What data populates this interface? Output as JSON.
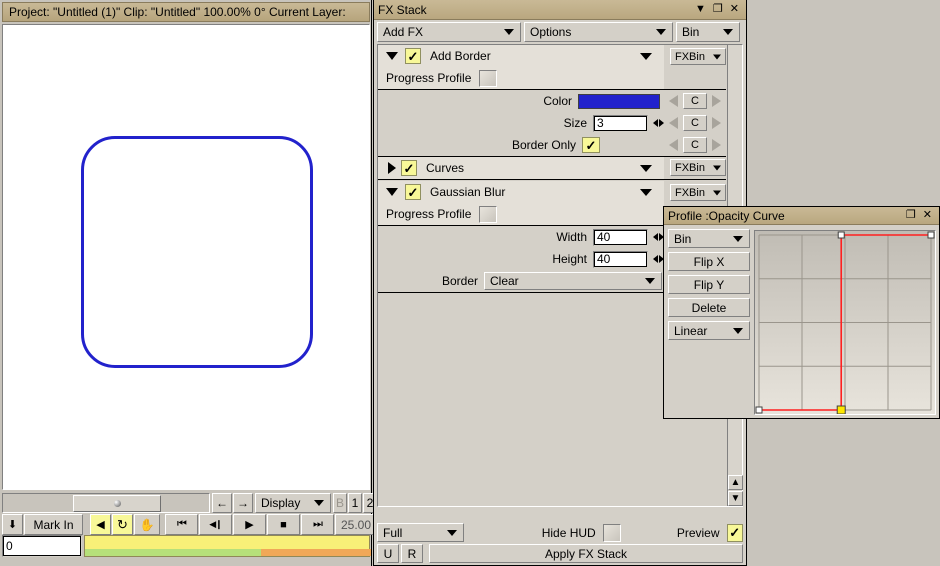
{
  "project": {
    "titlebar": "Project: \"Untitled (1)\"  Clip: \"Untitled\"   100.00%   0°  Current Layer:",
    "canvas_shape_color": "#2222cc"
  },
  "transport": {
    "mark_in": "Mark In",
    "down_arrow": "⬇",
    "fps": "25.00",
    "frame_value": "0",
    "buttons": [
      {
        "name": "loop-left-icon",
        "glyph": "◀",
        "active": true
      },
      {
        "name": "loop-cycle-icon",
        "glyph": "↻",
        "active": true
      },
      {
        "name": "hand-pan-icon",
        "glyph": "✋",
        "active": false
      },
      {
        "name": "go-to-start-icon",
        "glyph": "⏮",
        "active": false
      },
      {
        "name": "step-back-icon",
        "glyph": "◀❙",
        "active": false
      },
      {
        "name": "play-icon",
        "glyph": "▶",
        "active": false
      },
      {
        "name": "stop-icon",
        "glyph": "■",
        "active": false
      },
      {
        "name": "go-to-end-icon",
        "glyph": "⏭",
        "active": false
      }
    ]
  },
  "display_bar": {
    "left_arrow": "←",
    "right_arrow": "→",
    "display_label": "Display",
    "small_buttons": [
      "B",
      "1",
      "2"
    ]
  },
  "fx_stack": {
    "title": "FX Stack",
    "title_buttons": [
      "menu-chevron",
      "restore",
      "close"
    ],
    "toolbar": {
      "add_fx": "Add FX",
      "options": "Options",
      "bin": "Bin"
    },
    "effects": [
      {
        "name": "Add Border",
        "expanded": true,
        "enabled": true,
        "bin_label": "FXBin",
        "progress_profile_label": "Progress Profile",
        "params": [
          {
            "label": "Color",
            "type": "color",
            "value": "#2222cc",
            "c_button": "C"
          },
          {
            "label": "Size",
            "type": "text",
            "value": "3",
            "c_button": "C"
          },
          {
            "label": "Border Only",
            "type": "check",
            "value": true,
            "c_button": "C"
          }
        ]
      },
      {
        "name": "Curves",
        "expanded": false,
        "enabled": true,
        "bin_label": "FXBin",
        "params": []
      },
      {
        "name": "Gaussian Blur",
        "expanded": true,
        "enabled": true,
        "bin_label": "FXBin",
        "progress_profile_label": "Progress Profile",
        "params": [
          {
            "label": "Width",
            "type": "text",
            "value": "40"
          },
          {
            "label": "Height",
            "type": "text",
            "value": "40"
          },
          {
            "label": "Border",
            "type": "combo",
            "value": "Clear"
          }
        ]
      }
    ],
    "footer": {
      "quality": "Full",
      "hide_hud_label": "Hide HUD",
      "hide_hud_checked": false,
      "preview_label": "Preview",
      "preview_checked": true,
      "undo_label": "U",
      "redo_label": "R",
      "apply_label": "Apply FX Stack"
    }
  },
  "profile_window": {
    "title": "Profile :Opacity Curve",
    "title_buttons": [
      "restore",
      "close"
    ],
    "bin_label": "Bin",
    "flip_x_label": "Flip X",
    "flip_y_label": "Flip Y",
    "delete_label": "Delete",
    "interp_label": "Linear",
    "curve_color": "#ff2020",
    "selected_point_color": "#ffe800"
  },
  "chart_data": {
    "type": "line",
    "title": "Opacity Curve",
    "xlabel": "",
    "ylabel": "",
    "xlim": [
      0,
      1
    ],
    "ylim": [
      0,
      1
    ],
    "grid": true,
    "grid_divisions": 4,
    "legend": "none",
    "series": [
      {
        "name": "Opacity",
        "interpolation": "Linear",
        "x": [
          0.0,
          0.478,
          0.478,
          1.0
        ],
        "y": [
          0.0,
          0.0,
          1.0,
          1.0
        ],
        "points": [
          {
            "x": 0.0,
            "y": 0.0,
            "selected": false
          },
          {
            "x": 0.478,
            "y": 0.0,
            "selected": true
          },
          {
            "x": 0.478,
            "y": 1.0,
            "selected": false
          },
          {
            "x": 1.0,
            "y": 1.0,
            "selected": false
          }
        ]
      }
    ]
  }
}
